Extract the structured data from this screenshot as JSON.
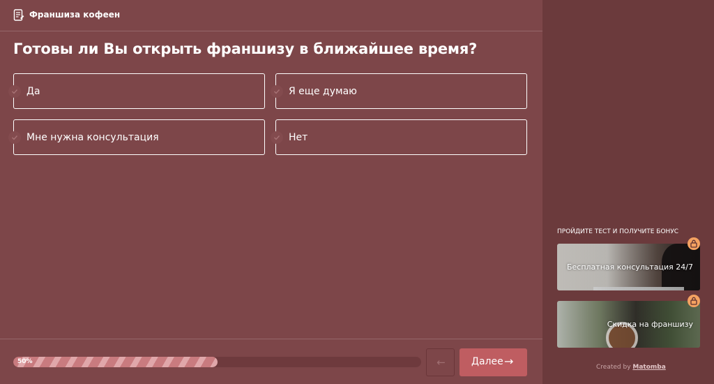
{
  "header": {
    "title": "Франшиза кофеен"
  },
  "question": {
    "text": "Готовы ли Вы открыть франшизу в ближайшее время?"
  },
  "options": [
    {
      "label": "Да"
    },
    {
      "label": "Я еще думаю"
    },
    {
      "label": "Мне нужна консультация"
    },
    {
      "label": "Нет"
    }
  ],
  "progress": {
    "value_percent": 50,
    "label": "50%"
  },
  "nav": {
    "back_symbol": "←",
    "next_label": "Далее",
    "next_symbol": "→"
  },
  "sidebar": {
    "bonus_title": "ПРОЙДИТЕ ТЕСТ И ПОЛУЧИТЕ БОНУС",
    "bonuses": [
      {
        "label": "Бесплатная консультация 24/7"
      },
      {
        "label": "Скидка на франшизу"
      }
    ],
    "credit_prefix": "Created by",
    "credit_brand": "Matomba"
  },
  "colors": {
    "main_bg": "#7d4649",
    "side_bg": "#6b3a3c",
    "accent_button": "#bf5d61",
    "lock_badge": "#f4a261"
  }
}
